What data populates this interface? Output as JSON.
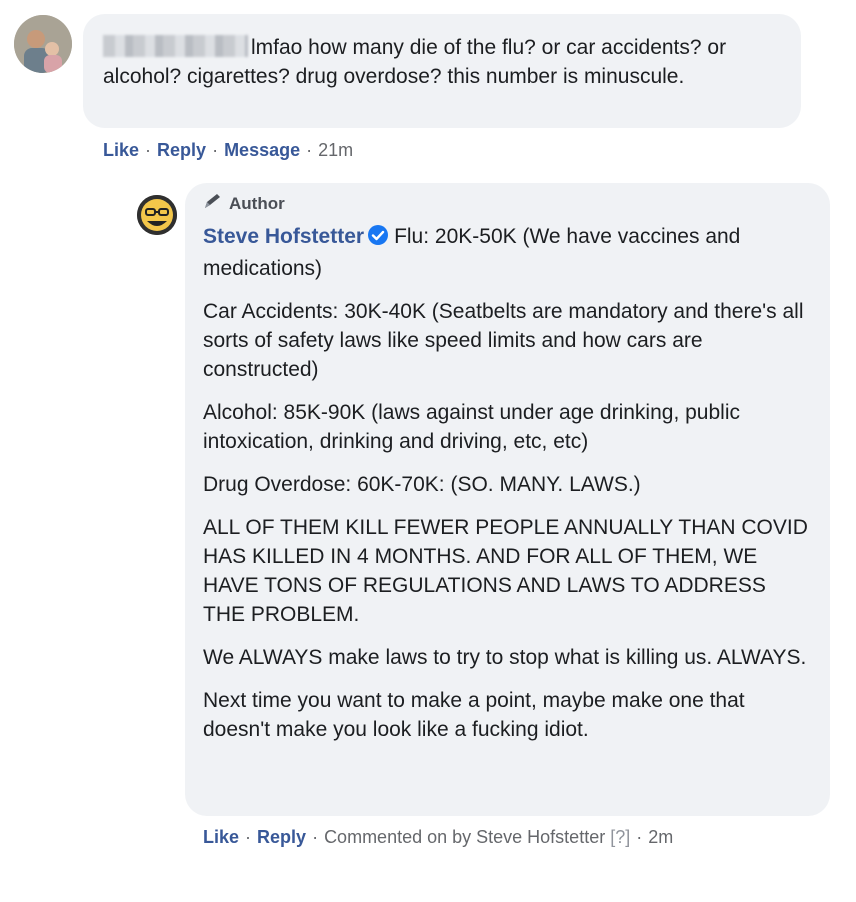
{
  "top_comment": {
    "text": "lmfao how many die of the flu? or car accidents? or alcohol? cigarettes? drug overdose? this number is minuscule.",
    "actions": {
      "like": "Like",
      "reply": "Reply",
      "message": "Message",
      "time": "21m"
    }
  },
  "reply_comment": {
    "badge": "Author",
    "author_name": "Steve Hofstetter",
    "first_paragraph": "Flu: 20K-50K (We have vaccines and medications)",
    "paragraphs": [
      "Car Accidents: 30K-40K (Seatbelts are mandatory and there's all sorts of safety laws like speed limits and how cars are constructed)",
      "Alcohol: 85K-90K (laws against under age drinking, public intoxication, drinking and driving, etc, etc)",
      "Drug Overdose: 60K-70K: (SO. MANY. LAWS.)",
      "ALL OF THEM KILL FEWER PEOPLE ANNUALLY THAN COVID HAS KILLED IN 4 MONTHS. AND FOR ALL OF THEM, WE HAVE TONS OF REGULATIONS AND LAWS TO ADDRESS THE PROBLEM.",
      "We ALWAYS make laws to try to stop what is killing us. ALWAYS.",
      "Next time you want to make a point, maybe make one that doesn't make you look like a fucking idiot."
    ],
    "actions": {
      "like": "Like",
      "reply": "Reply",
      "commented_on_by": "Commented on by Steve Hofstetter",
      "help": "[?]",
      "time": "2m"
    }
  },
  "icons": {
    "verified": "verified-badge-icon",
    "author": "pencil-icon",
    "verified_color": "#1877f2"
  }
}
